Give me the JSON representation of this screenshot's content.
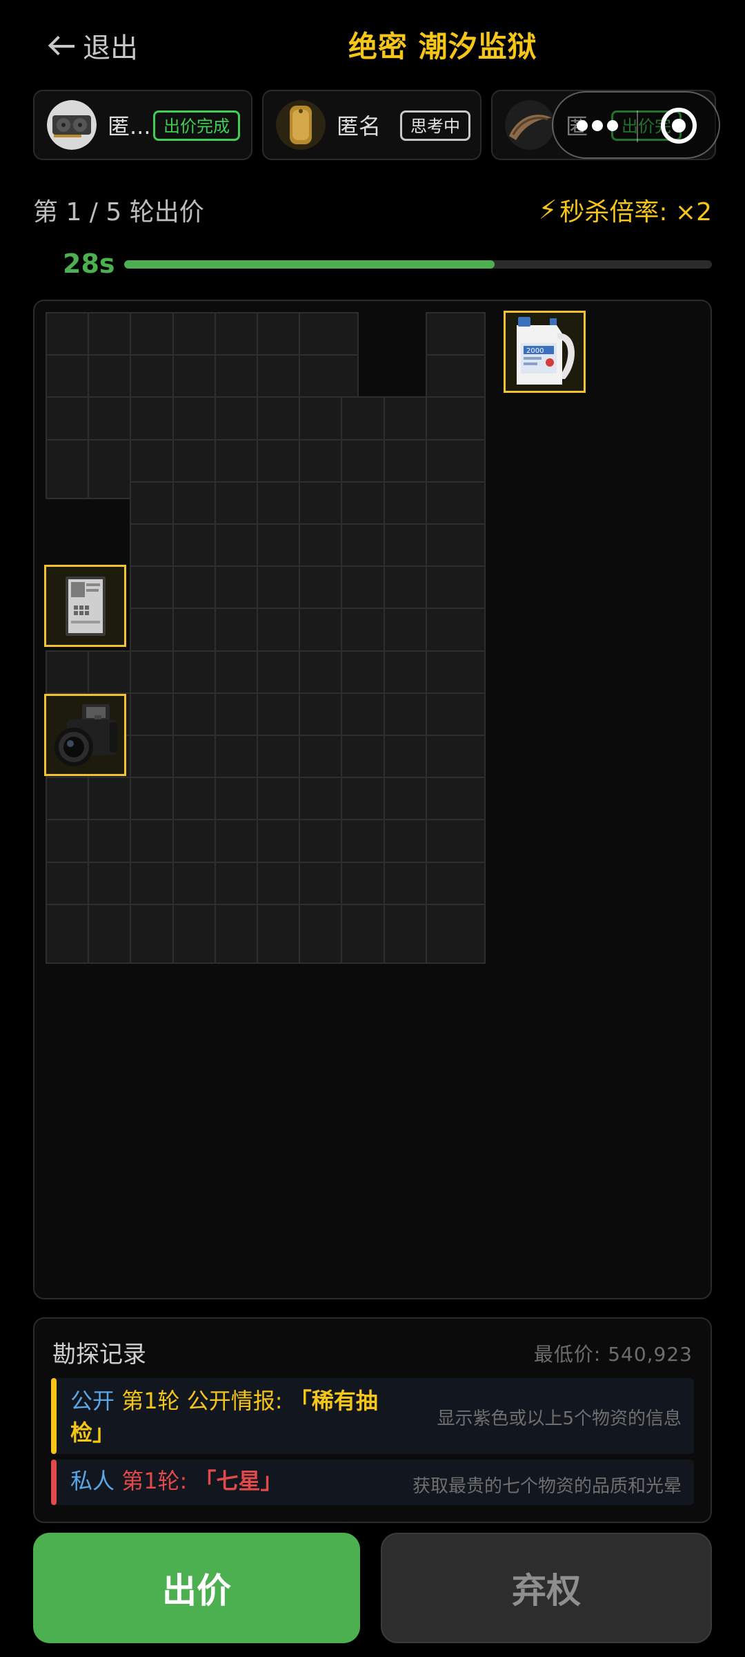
{
  "header": {
    "back_label": "退出",
    "title": "绝密 潮汐监狱"
  },
  "players": [
    {
      "name": "匿...",
      "status": "出价完成",
      "status_type": "done",
      "avatar": "graphics-card-avatar"
    },
    {
      "name": "匿名",
      "status": "思考中",
      "status_type": "thinking",
      "avatar": "gold-tag-avatar"
    },
    {
      "name": "匿",
      "status": "出价完",
      "status_type": "done",
      "avatar": "horn-avatar"
    }
  ],
  "round": {
    "label": "第 1 / 5 轮出价",
    "rate_label": "秒杀倍率: ×2",
    "timer": "28s",
    "progress_fraction": 0.63
  },
  "grid": {
    "columns": 10,
    "rows": 15,
    "items": [
      {
        "name": "water-jug-item",
        "col": 7,
        "row": 0,
        "w": 2,
        "h": 2
      },
      {
        "name": "document-folder-item",
        "col": 0,
        "row": 4,
        "w": 2,
        "h": 2
      },
      {
        "name": "camera-item",
        "col": 0,
        "row": 6,
        "w": 2,
        "h": 2
      }
    ]
  },
  "records": {
    "title": "勘探记录",
    "min_price": "最低价: 540,923",
    "entries": [
      {
        "scope": "公开",
        "round": "第1轮",
        "text": "公开情报:",
        "highlight": "「稀有抽检」",
        "desc": "显示紫色或以上5个物资的信息"
      },
      {
        "scope": "私人",
        "round": "第1轮:",
        "text": "",
        "highlight": "「七星」",
        "desc": "获取最贵的七个物资的品质和光晕"
      }
    ]
  },
  "actions": {
    "bid_label": "出价",
    "pass_label": "弃权"
  },
  "colors": {
    "accent_yellow": "#f5c518",
    "accent_green": "#4caf50",
    "accent_red": "#e04a4a",
    "accent_blue": "#5aa6e6"
  }
}
